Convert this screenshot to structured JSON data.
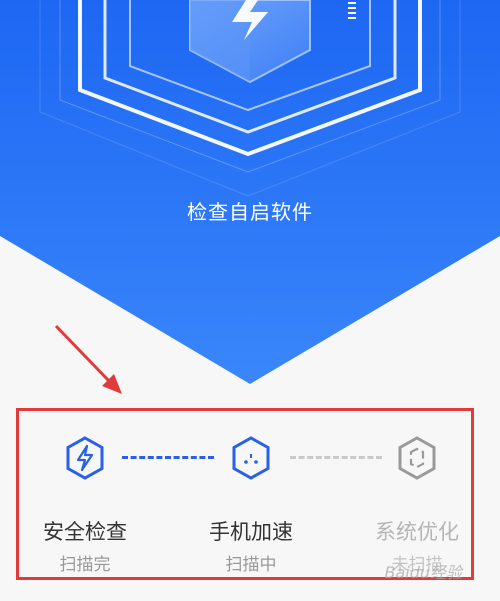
{
  "hero": {
    "status_text": "检查自启软件",
    "bg_color_top": "#1e6cf5",
    "bg_color_bottom": "#2f7ef8",
    "icon": "shield-bolt-icon"
  },
  "steps": [
    {
      "title": "安全检查",
      "status": "扫描完",
      "icon": "bolt-hexagon-icon",
      "state": "done"
    },
    {
      "title": "手机加速",
      "status": "扫描中",
      "icon": "speed-hexagon-icon",
      "state": "active"
    },
    {
      "title": "系统优化",
      "status": "未扫描",
      "icon": "optimize-hexagon-icon",
      "state": "pending"
    }
  ],
  "watermark": "Baidu经验",
  "colors": {
    "accent": "#2a5fe8",
    "highlight": "#e23a3a",
    "pending": "#c9c9c9"
  }
}
